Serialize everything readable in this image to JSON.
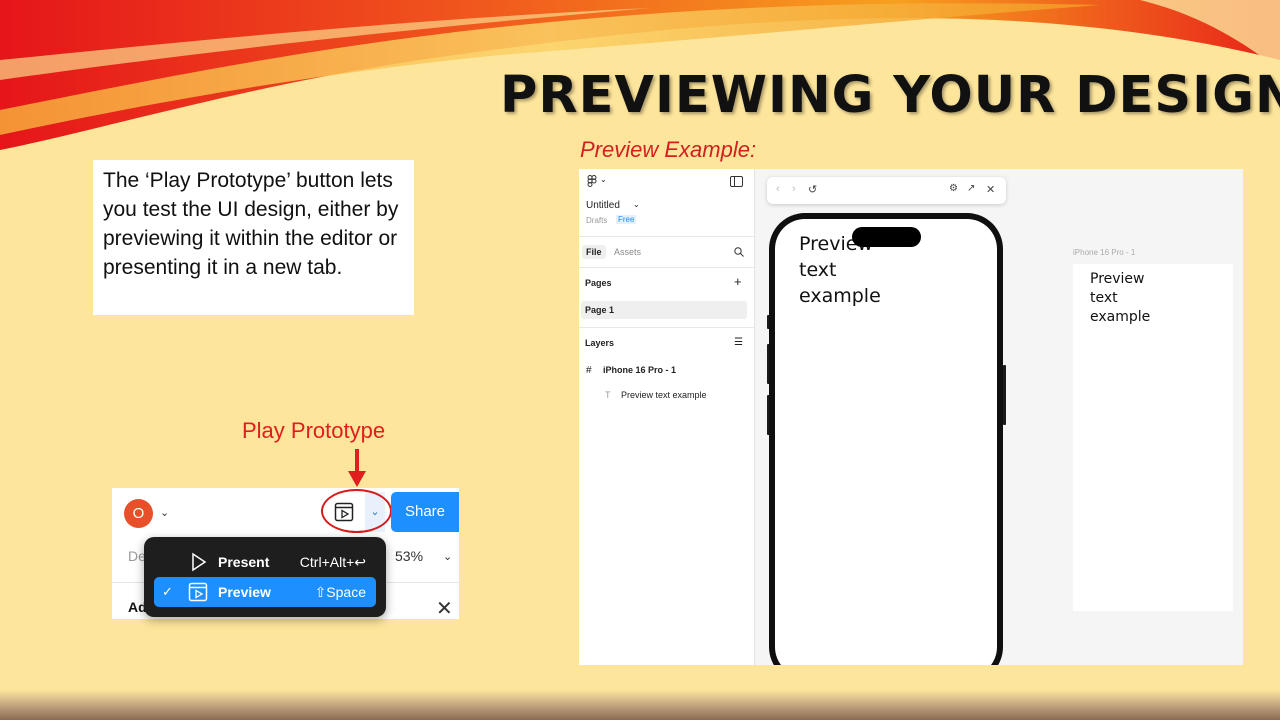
{
  "slide": {
    "title": "PREVIEWING YOUR DESIGN",
    "caption": "Preview Example:",
    "description": "The ‘Play Prototype’ button lets you test the UI design, either by previewing it within the editor or presenting it in a new tab.",
    "play_label": "Play Prototype"
  },
  "toolbar": {
    "avatar": "O",
    "share": "Share",
    "row_left": "De",
    "zoom": "53%",
    "row_below": "Ad",
    "close_icon": "close-icon",
    "play_icon": "play-prototype-icon"
  },
  "menu": {
    "items": [
      {
        "label": "Present",
        "shortcut": "Ctrl+Alt+↩",
        "icon": "play-icon",
        "checked": false
      },
      {
        "label": "Preview",
        "shortcut": "⇧Space",
        "icon": "preview-icon",
        "checked": true
      }
    ],
    "check": "✓"
  },
  "figma": {
    "file_name": "Untitled",
    "drafts": "Drafts",
    "plan": "Free",
    "tabs": [
      "File",
      "Assets"
    ],
    "pages_header": "Pages",
    "page": "Page 1",
    "layers_header": "Layers",
    "layer_frame": "iPhone 16 Pro - 1",
    "layer_text": "Preview text example",
    "frame_label": "iPhone 16 Pro - 1",
    "preview_text": "Preview\ntext\nexample",
    "colors": {
      "accent": "#1e8fff",
      "highlight": "#d71a1a",
      "plan_badge": "#1e8fff"
    }
  }
}
